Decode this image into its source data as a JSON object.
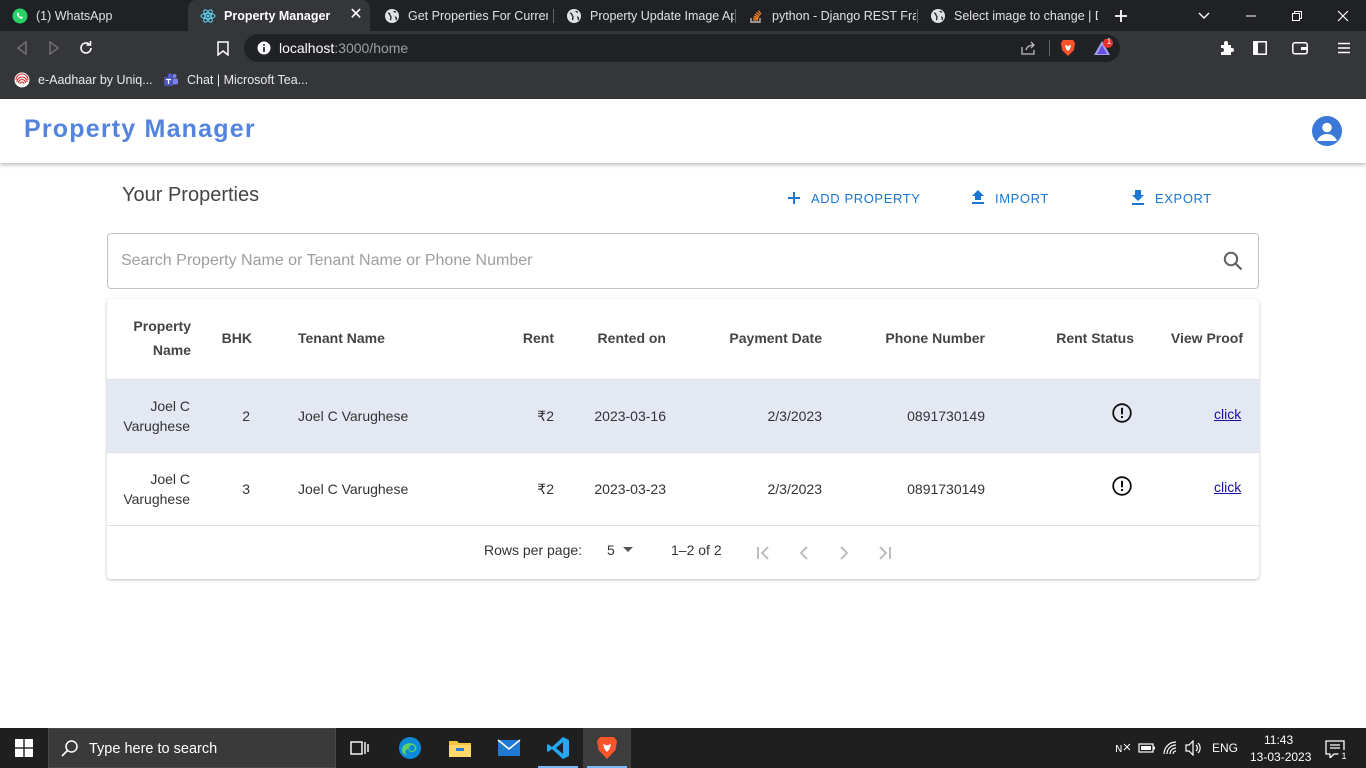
{
  "browser": {
    "tabs": [
      {
        "title": "(1) WhatsApp",
        "icon": "whatsapp-icon"
      },
      {
        "title": "Property Manager",
        "icon": "react-icon",
        "active": true
      },
      {
        "title": "Get Properties For Current",
        "icon": "globe-icon"
      },
      {
        "title": "Property Update Image Api",
        "icon": "globe-icon"
      },
      {
        "title": "python - Django REST Fram",
        "icon": "stackoverflow-icon"
      },
      {
        "title": "Select image to change | Dj",
        "icon": "globe-icon"
      }
    ],
    "address": {
      "host": "localhost",
      "path": ":3000/home"
    },
    "brave_badge": "1",
    "bookmarks": [
      {
        "label": "e-Aadhaar by Uniq...",
        "icon": "aadhaar-icon"
      },
      {
        "label": "Chat | Microsoft Tea...",
        "icon": "teams-icon"
      }
    ]
  },
  "app": {
    "title": "Property Manager",
    "heading": "Your Properties",
    "actions": {
      "add": "ADD PROPERTY",
      "import": "IMPORT",
      "export": "EXPORT"
    },
    "search": {
      "placeholder": "Search Property Name or Tenant Name or Phone Number",
      "value": ""
    },
    "table": {
      "columns": {
        "property_name_line1": "Property",
        "property_name_line2": "Name",
        "bhk": "BHK",
        "tenant_name": "Tenant Name",
        "rent": "Rent",
        "rented_on": "Rented on",
        "payment_date": "Payment Date",
        "phone_number": "Phone Number",
        "rent_status": "Rent Status",
        "view_proof": "View Proof"
      },
      "rows": [
        {
          "property_line1": "Joel C",
          "property_line2": "Varughese",
          "bhk": "2",
          "tenant_name": "Joel C Varughese",
          "rent": "₹2",
          "rented_on": "2023-03-16",
          "payment_date": "2/3/2023",
          "phone_number": "0891730149",
          "rent_status_icon": "alert-circle-icon",
          "proof_link": "click"
        },
        {
          "property_line1": "Joel C",
          "property_line2": "Varughese",
          "bhk": "3",
          "tenant_name": "Joel C Varughese",
          "rent": "₹2",
          "rented_on": "2023-03-23",
          "payment_date": "2/3/2023",
          "phone_number": "0891730149",
          "rent_status_icon": "alert-circle-icon",
          "proof_link": "click"
        }
      ]
    },
    "pagination": {
      "rows_per_page_label": "Rows per page:",
      "rows_per_page": "5",
      "range": "1–2 of 2"
    },
    "colors": {
      "brand": "#5484dd",
      "action": "#1976d2",
      "selected_row": "#e3e8f3",
      "link": "#1a0dab"
    }
  },
  "taskbar": {
    "search_placeholder": "Type here to search",
    "language": "ENG",
    "time": "11:43",
    "date": "13-03-2023",
    "notification_count": "1"
  }
}
